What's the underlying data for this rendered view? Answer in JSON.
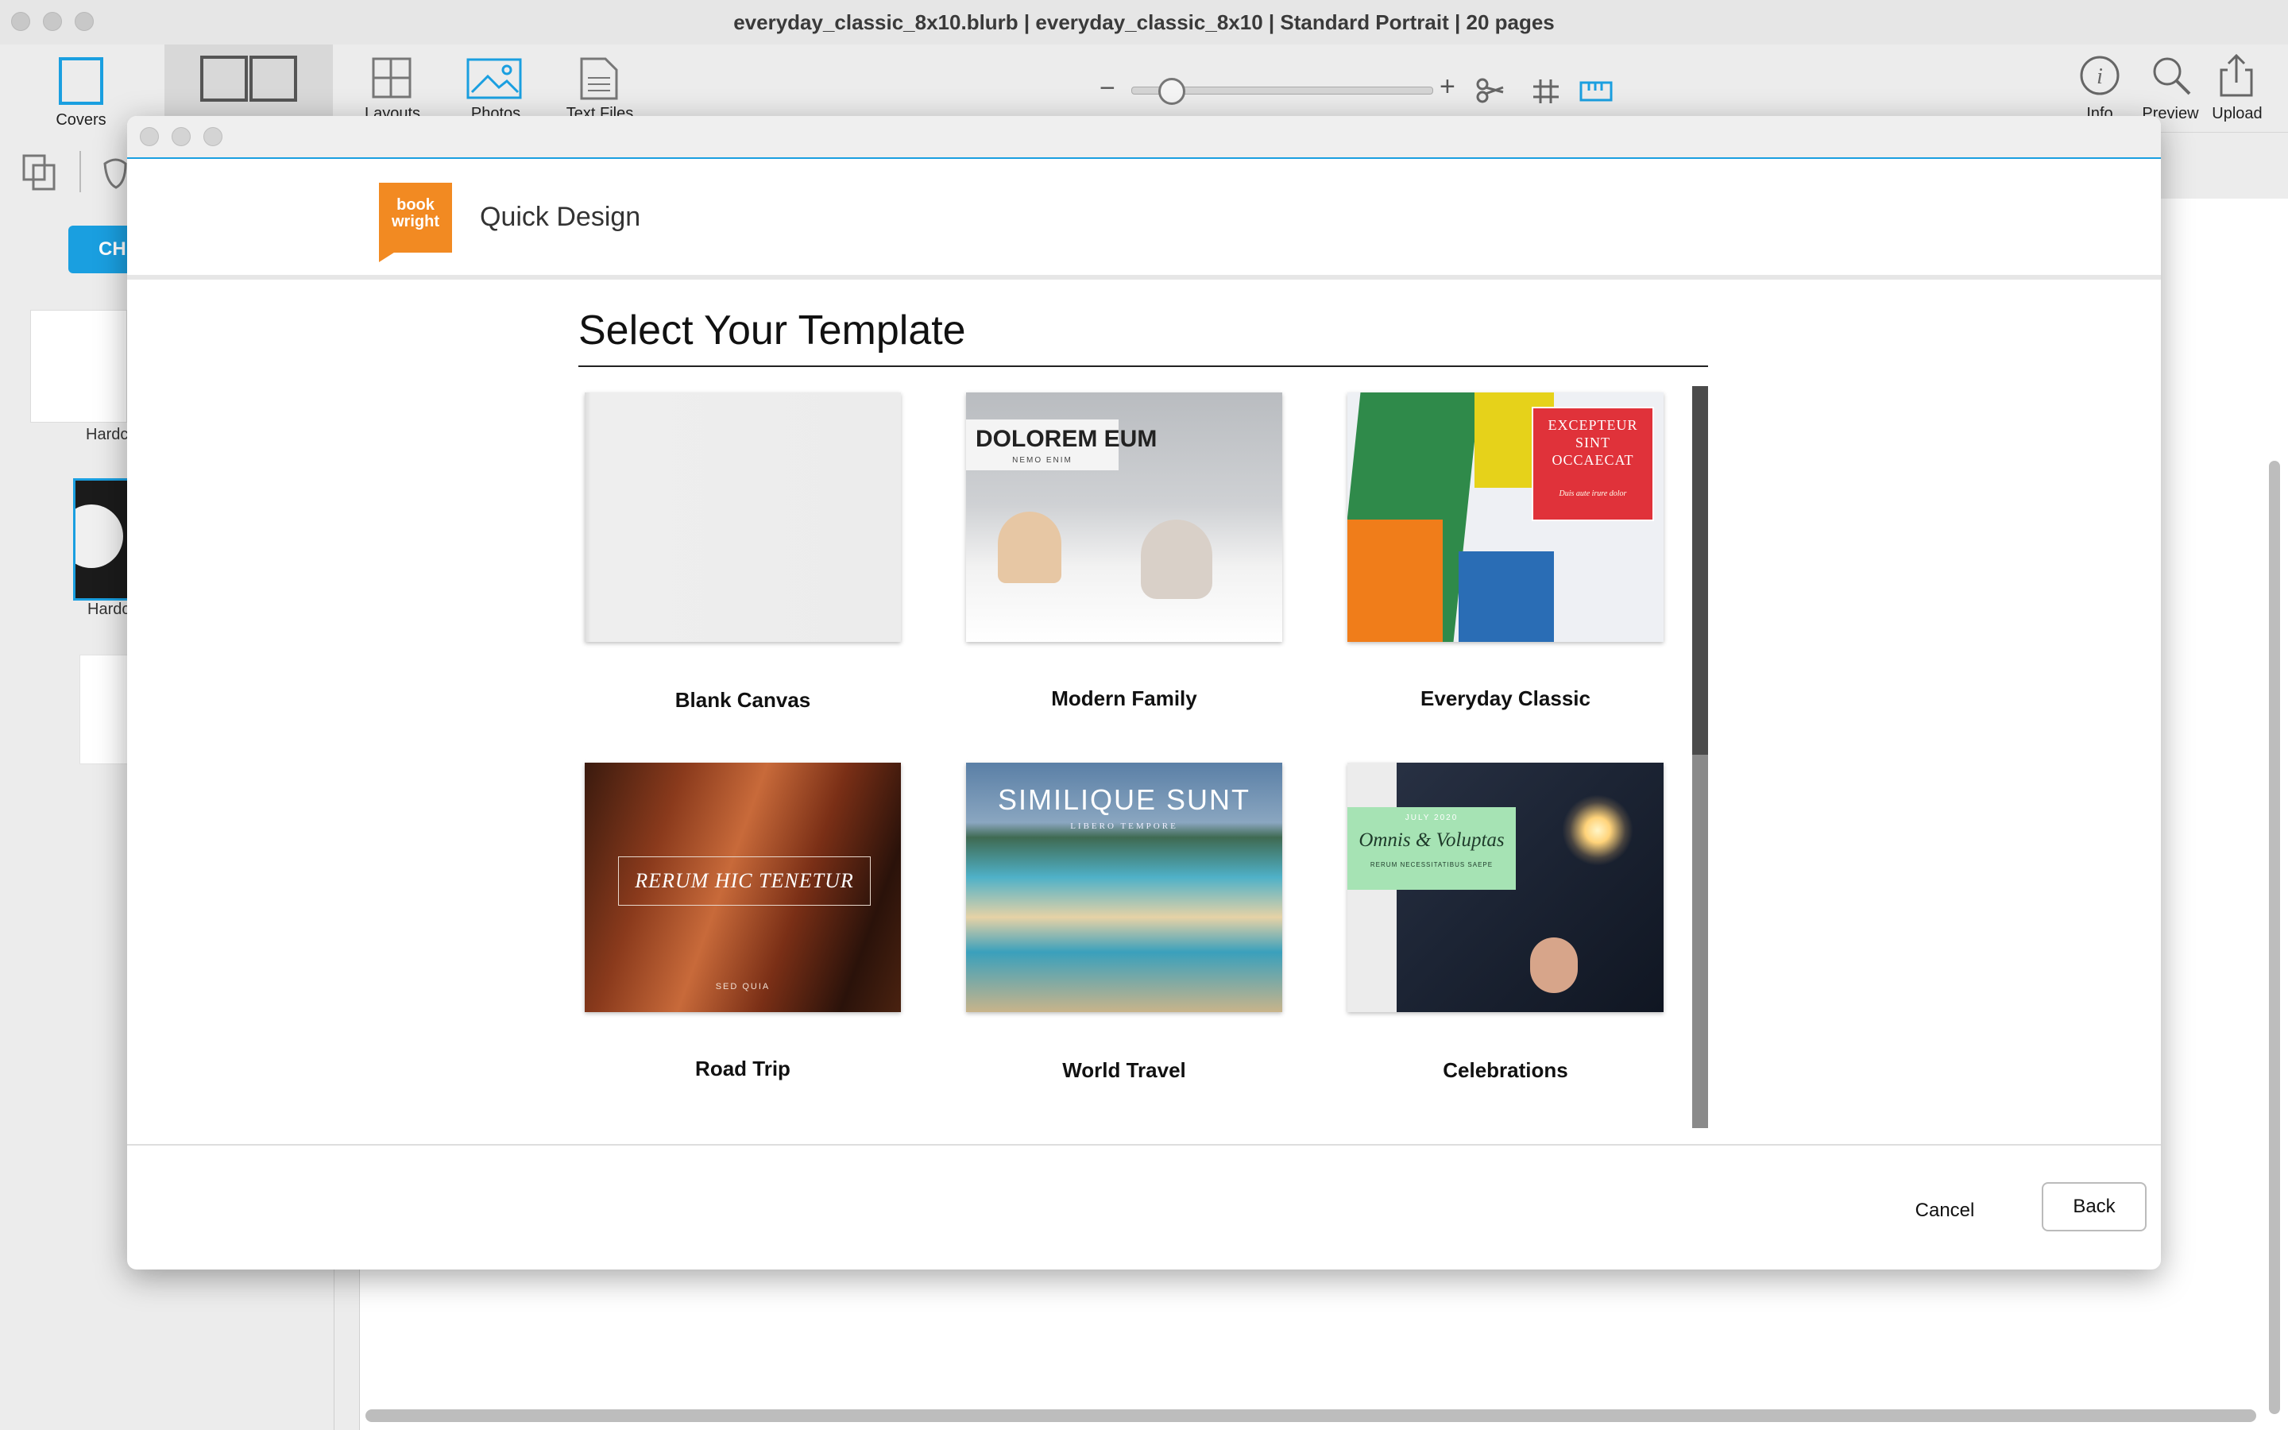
{
  "window": {
    "title": "everyday_classic_8x10.blurb | everyday_classic_8x10 | Standard Portrait | 20 pages"
  },
  "toolbar": {
    "covers_label": "Covers",
    "layouts_label": "Layouts",
    "photos_label": "Photos",
    "text_files_label": "Text Files",
    "zoom_minus": "−",
    "zoom_plus": "+",
    "zoom_level": 0.1,
    "info_label": "Info",
    "preview_label": "Preview",
    "upload_label": "Upload"
  },
  "sidebar": {
    "button_label": "CH",
    "thumb1_label": "Hardc",
    "thumb2_label": "Hardc"
  },
  "dialog": {
    "logo_line1": "book",
    "logo_line2": "wright",
    "title": "Quick Design",
    "section_title": "Select Your Template",
    "templates": [
      {
        "name": "Blank Canvas"
      },
      {
        "name": "Modern Family",
        "cover_title": "DOLOREM EUM",
        "cover_subtitle": "NEMO ENIM"
      },
      {
        "name": "Everyday Classic",
        "cover_title_1": "EXCEPTEUR",
        "cover_title_2": "SINT",
        "cover_title_3": "OCCAECAT",
        "cover_subtitle": "Duis aute irure dolor"
      },
      {
        "name": "Road Trip",
        "cover_title": "RERUM HIC TENETUR",
        "cover_subtitle": "SED QUIA"
      },
      {
        "name": "World Travel",
        "cover_title": "SIMILIQUE SUNT",
        "cover_subtitle": "LIBERO TEMPORE"
      },
      {
        "name": "Celebrations",
        "cover_date": "JULY 2020",
        "cover_title": "Omnis & Voluptas",
        "cover_subtitle": "RERUM NECESSITATIBUS SAEPE"
      }
    ],
    "cancel_label": "Cancel",
    "back_label": "Back"
  },
  "colors": {
    "accent_blue": "#1a9fe0",
    "logo_orange": "#f28a22",
    "classic_red": "#e0323a",
    "celebrations_green": "#a6e3b4"
  }
}
